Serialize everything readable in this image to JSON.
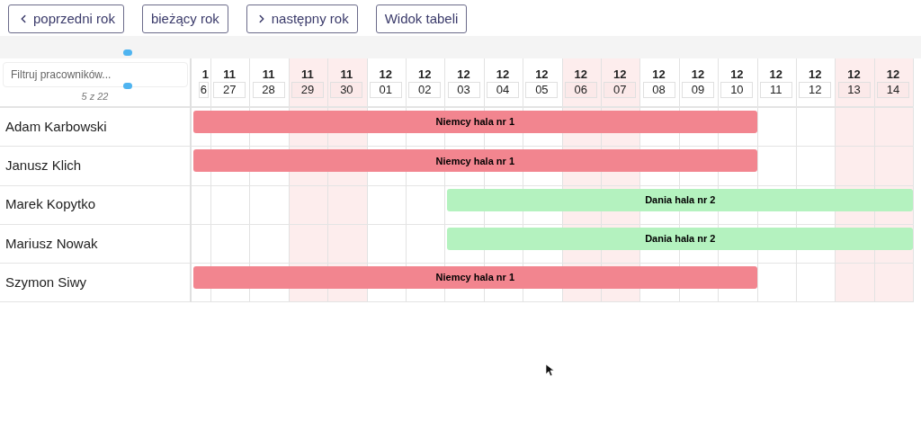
{
  "toolbar": [
    {
      "label": "poprzedni rok",
      "kind": "prev"
    },
    {
      "label": "bieżący rok",
      "kind": "plain"
    },
    {
      "label": "następny rok",
      "kind": "next"
    },
    {
      "label": "Widok tabeli",
      "kind": "plain"
    }
  ],
  "filter": {
    "placeholder": "Filtruj pracowników...",
    "count": "5 z 22"
  },
  "days": [
    {
      "month": "1",
      "day": "6",
      "weekend": false
    },
    {
      "month": "11",
      "day": "27",
      "weekend": false
    },
    {
      "month": "11",
      "day": "28",
      "weekend": false
    },
    {
      "month": "11",
      "day": "29",
      "weekend": true
    },
    {
      "month": "11",
      "day": "30",
      "weekend": true
    },
    {
      "month": "12",
      "day": "01",
      "weekend": false
    },
    {
      "month": "12",
      "day": "02",
      "weekend": false
    },
    {
      "month": "12",
      "day": "03",
      "weekend": false
    },
    {
      "month": "12",
      "day": "04",
      "weekend": false
    },
    {
      "month": "12",
      "day": "05",
      "weekend": false
    },
    {
      "month": "12",
      "day": "06",
      "weekend": true
    },
    {
      "month": "12",
      "day": "07",
      "weekend": true
    },
    {
      "month": "12",
      "day": "08",
      "weekend": false
    },
    {
      "month": "12",
      "day": "09",
      "weekend": false
    },
    {
      "month": "12",
      "day": "10",
      "weekend": false
    },
    {
      "month": "12",
      "day": "11",
      "weekend": false
    },
    {
      "month": "12",
      "day": "12",
      "weekend": false
    },
    {
      "month": "12",
      "day": "13",
      "weekend": true
    },
    {
      "month": "12",
      "day": "14",
      "weekend": true
    }
  ],
  "employees": [
    {
      "name": "Adam Karbowski",
      "bar": {
        "label": "Niemcy hala nr 1",
        "color": "#f2858f",
        "booked": [
          true,
          true,
          true,
          true,
          true,
          true,
          true,
          true,
          true,
          true,
          true,
          true,
          true,
          true,
          true,
          false,
          false,
          false,
          false
        ]
      }
    },
    {
      "name": "Janusz Klich",
      "bar": {
        "label": "Niemcy hala nr 1",
        "color": "#f2858f",
        "booked": [
          true,
          true,
          true,
          true,
          true,
          true,
          true,
          true,
          true,
          true,
          true,
          true,
          true,
          true,
          true,
          false,
          false,
          false,
          false
        ]
      }
    },
    {
      "name": "Marek Kopytko",
      "bar": {
        "label": "Dania hala nr 2",
        "color": "#b4f2bf",
        "booked": [
          false,
          false,
          false,
          false,
          false,
          false,
          false,
          true,
          true,
          true,
          true,
          true,
          true,
          true,
          true,
          true,
          true,
          true,
          true
        ]
      }
    },
    {
      "name": "Mariusz Nowak",
      "bar": {
        "label": "Dania hala nr 2",
        "color": "#b4f2bf",
        "booked": [
          false,
          false,
          false,
          false,
          false,
          false,
          false,
          true,
          true,
          true,
          true,
          true,
          true,
          true,
          true,
          true,
          true,
          true,
          true
        ]
      }
    },
    {
      "name": "Szymon Siwy",
      "bar": {
        "label": "Niemcy hala nr 1",
        "color": "#f2858f",
        "booked": [
          true,
          true,
          true,
          true,
          true,
          true,
          true,
          true,
          true,
          true,
          true,
          true,
          true,
          true,
          true,
          false,
          false,
          false,
          false
        ]
      }
    }
  ]
}
